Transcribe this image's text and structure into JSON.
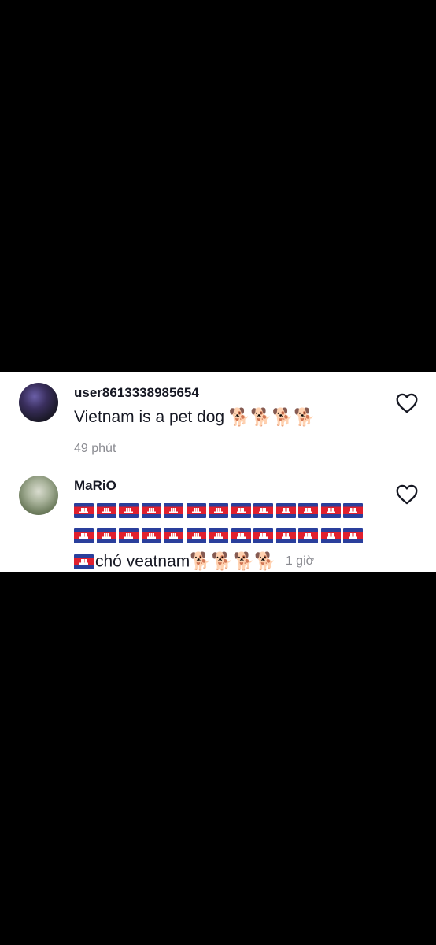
{
  "comments": [
    {
      "username": "user8613338985654",
      "text": "Vietnam is a pet dog",
      "emoji": "🐕🐕🐕🐕",
      "time": "49 phút"
    },
    {
      "username": "MaRiO",
      "flags_line1": "🇰🇭🇰🇭🇰🇭🇰🇭🇰🇭🇰🇭🇰🇭🇰🇭🇰🇭🇰🇭🇰🇭🇰🇭🇰🇭",
      "flags_line2": "🇰🇭🇰🇭🇰🇭🇰🇭🇰🇭🇰🇭🇰🇭🇰🇭🇰🇭🇰🇭🇰🇭🇰🇭🇰🇭",
      "lead_flag": "🇰🇭",
      "text": "chó veatnam",
      "emoji": "🐕🐕🐕🐕",
      "time": "1 giờ"
    }
  ],
  "icons": {
    "like": "heart-outline-icon",
    "flag": "cambodia-flag-icon",
    "dog": "dog-emoji"
  },
  "colors": {
    "background": "#000000",
    "panel": "#ffffff",
    "text": "#161823",
    "muted": "#8a8b91"
  }
}
